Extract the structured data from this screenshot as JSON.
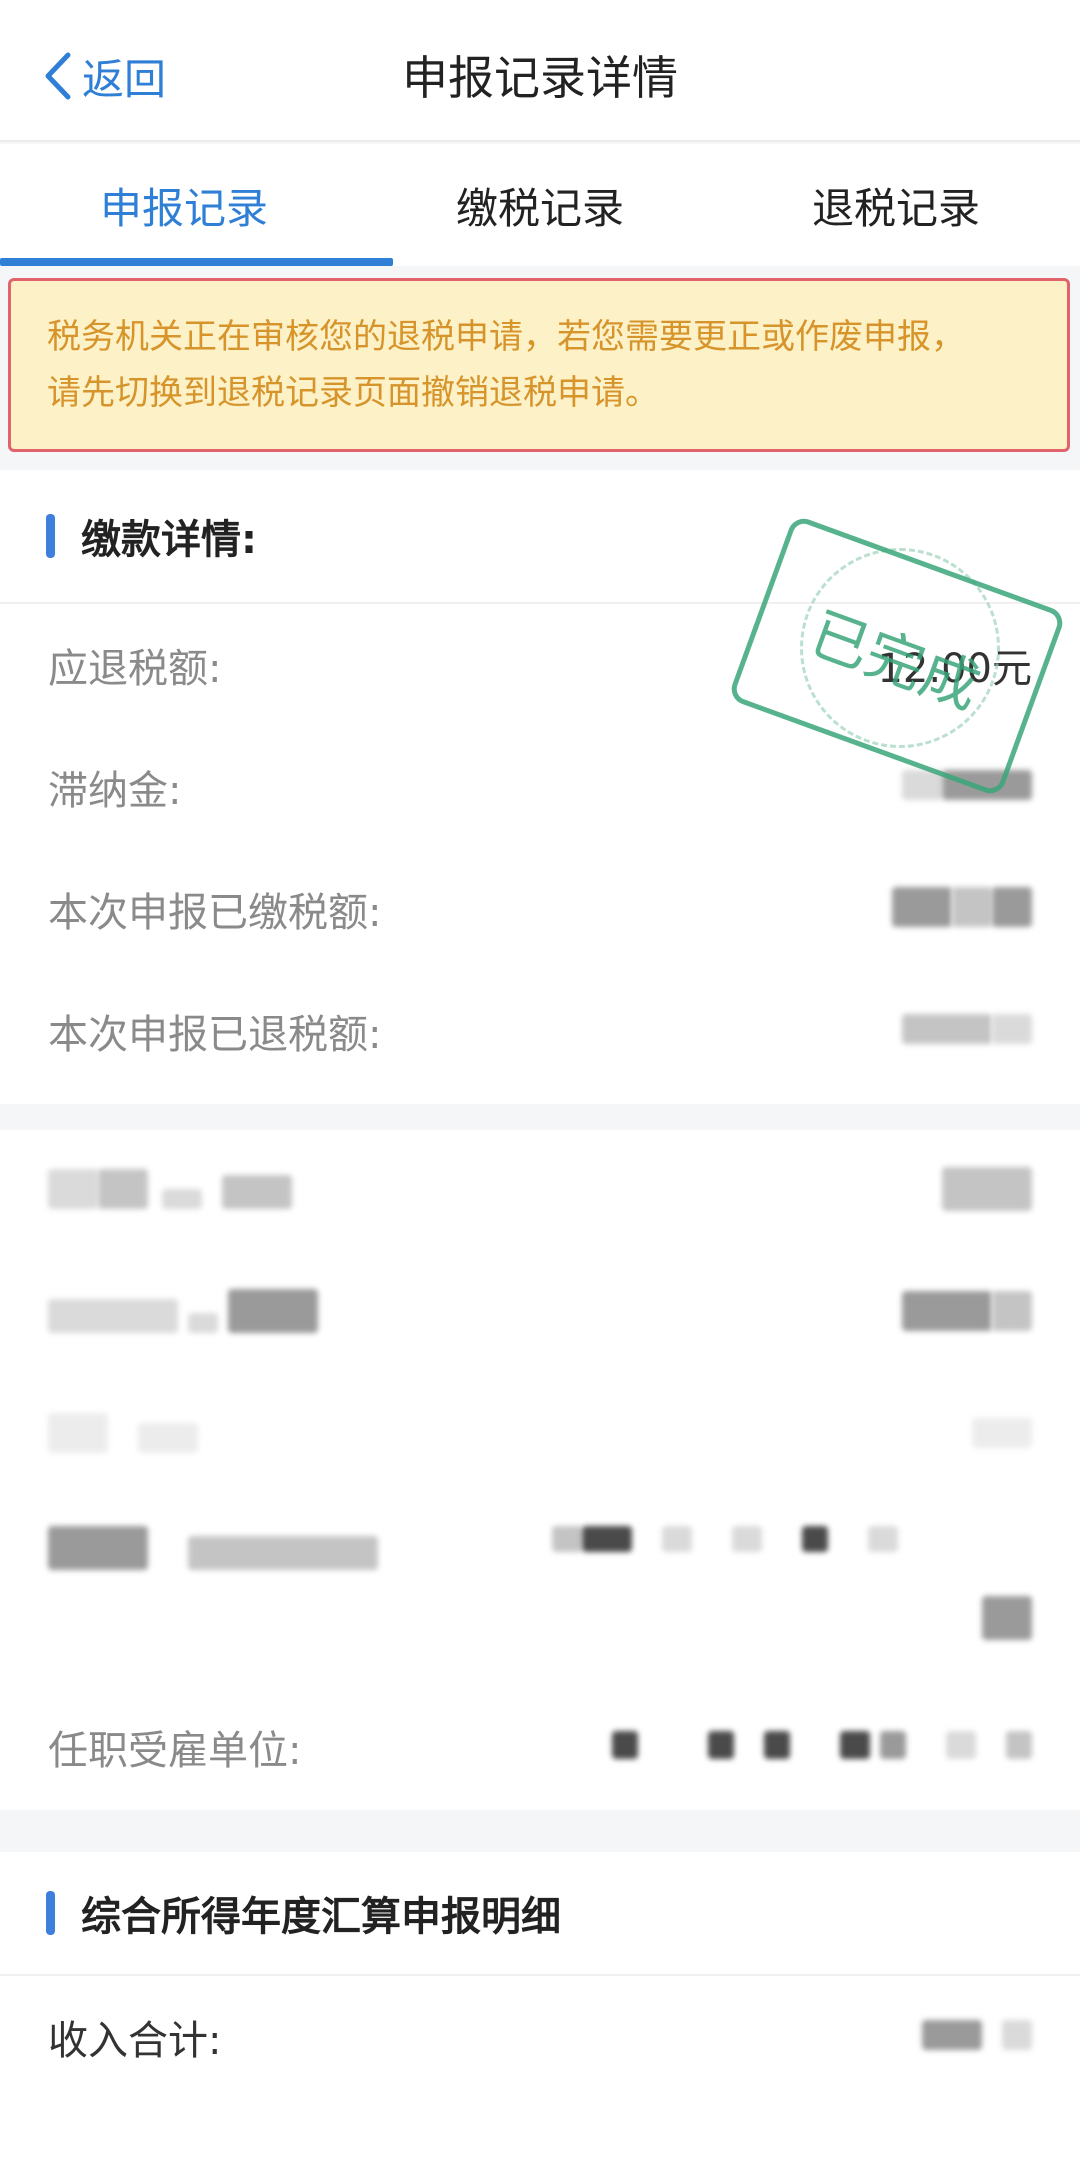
{
  "nav": {
    "back_label": "返回",
    "title": "申报记录详情"
  },
  "tabs": [
    {
      "label": "申报记录",
      "active": true
    },
    {
      "label": "缴税记录",
      "active": false
    },
    {
      "label": "退税记录",
      "active": false
    }
  ],
  "notice": {
    "line1": "税务机关正在审核您的退税申请，若您需要更正或作废申报，",
    "line2": "请先切换到退税记录页面撤销退税申请。"
  },
  "payment_section": {
    "title": "缴款详情:",
    "stamp": "已完成",
    "rows": [
      {
        "label": "应退税额:",
        "value": "12.00元"
      },
      {
        "label": "滞纳金:",
        "value": ""
      },
      {
        "label": "本次申报已缴税额:",
        "value": ""
      },
      {
        "label": "本次申报已退税额:",
        "value": ""
      }
    ]
  },
  "info_section": {
    "employer_label": "任职受雇单位:"
  },
  "detail_section": {
    "title": "综合所得年度汇算申报明细",
    "rows": [
      {
        "label": "收入合计:",
        "value": ""
      }
    ]
  },
  "colors": {
    "accent": "#2f7fd6",
    "notice_bg": "#fdf1c8",
    "notice_border": "#e0646b",
    "notice_text": "#d6942a",
    "stamp": "#3aa67a"
  }
}
